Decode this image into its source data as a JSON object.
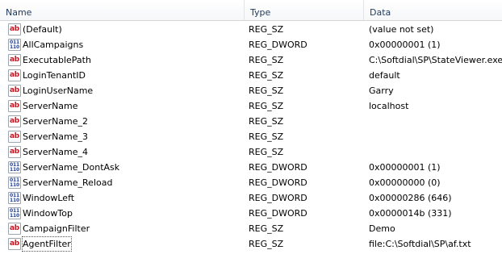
{
  "columns": {
    "name": "Name",
    "type": "Type",
    "data": "Data"
  },
  "values": [
    {
      "name": "(Default)",
      "type": "REG_SZ",
      "data": "(value not set)",
      "icon": "string-value-icon"
    },
    {
      "name": "AllCampaigns",
      "type": "REG_DWORD",
      "data": "0x00000001 (1)",
      "icon": "binary-value-icon"
    },
    {
      "name": "ExecutablePath",
      "type": "REG_SZ",
      "data": "C:\\Softdial\\SP\\StateViewer.exe",
      "icon": "string-value-icon"
    },
    {
      "name": "LoginTenantID",
      "type": "REG_SZ",
      "data": "default",
      "icon": "string-value-icon"
    },
    {
      "name": "LoginUserName",
      "type": "REG_SZ",
      "data": "Garry",
      "icon": "string-value-icon"
    },
    {
      "name": "ServerName",
      "type": "REG_SZ",
      "data": "localhost",
      "icon": "string-value-icon"
    },
    {
      "name": "ServerName_2",
      "type": "REG_SZ",
      "data": "",
      "icon": "string-value-icon"
    },
    {
      "name": "ServerName_3",
      "type": "REG_SZ",
      "data": "",
      "icon": "string-value-icon"
    },
    {
      "name": "ServerName_4",
      "type": "REG_SZ",
      "data": "",
      "icon": "string-value-icon"
    },
    {
      "name": "ServerName_DontAsk",
      "type": "REG_DWORD",
      "data": "0x00000001 (1)",
      "icon": "binary-value-icon"
    },
    {
      "name": "ServerName_Reload",
      "type": "REG_DWORD",
      "data": "0x00000000 (0)",
      "icon": "binary-value-icon"
    },
    {
      "name": "WindowLeft",
      "type": "REG_DWORD",
      "data": "0x00000286 (646)",
      "icon": "binary-value-icon"
    },
    {
      "name": "WindowTop",
      "type": "REG_DWORD",
      "data": "0x0000014b (331)",
      "icon": "binary-value-icon"
    },
    {
      "name": "CampaignFilter",
      "type": "REG_SZ",
      "data": "Demo",
      "icon": "string-value-icon"
    },
    {
      "name": "AgentFilter",
      "type": "REG_SZ",
      "data": "file:C:\\Softdial\\SP\\af.txt",
      "icon": "string-value-icon",
      "focused": true
    }
  ],
  "icons": {
    "string-value-icon": {
      "glyph": "ab",
      "color": "#c8141e"
    },
    "binary-value-icon": {
      "glyph_lines": [
        "011",
        "110"
      ],
      "color": "#1f3f99"
    }
  }
}
